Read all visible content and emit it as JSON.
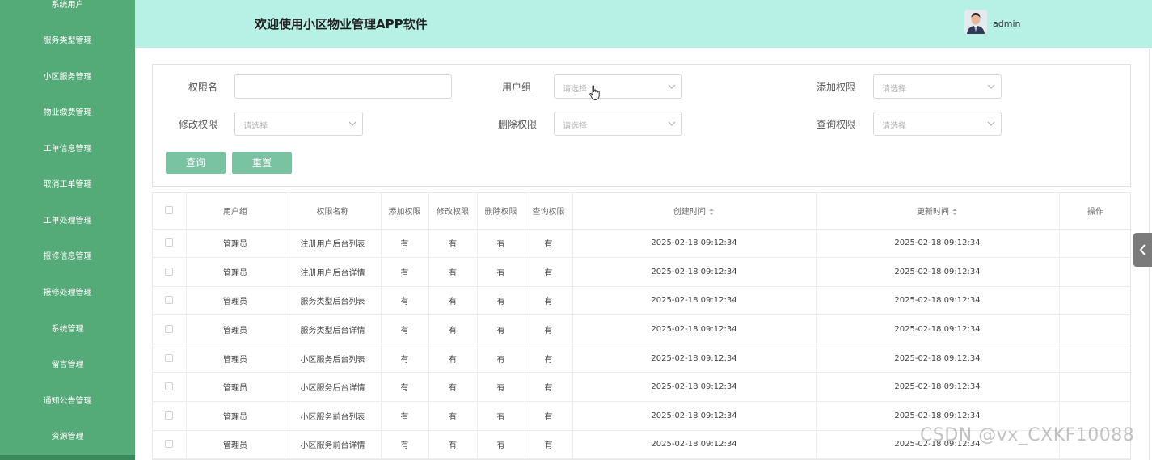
{
  "sidebar": {
    "items": [
      {
        "label": "系统用户"
      },
      {
        "label": "服务类型管理"
      },
      {
        "label": "小区服务管理"
      },
      {
        "label": "物业缴费管理"
      },
      {
        "label": "工单信息管理"
      },
      {
        "label": "取消工单管理"
      },
      {
        "label": "工单处理管理"
      },
      {
        "label": "报修信息管理"
      },
      {
        "label": "报修处理管理"
      },
      {
        "label": "系统管理"
      },
      {
        "label": "留言管理"
      },
      {
        "label": "通知公告管理"
      },
      {
        "label": "资源管理"
      }
    ]
  },
  "header": {
    "title": "欢迎使用小区物业管理APP软件",
    "username": "admin"
  },
  "search": {
    "perm_name_label": "权限名",
    "user_group_label": "用户组",
    "add_perm_label": "添加权限",
    "edit_perm_label": "修改权限",
    "delete_perm_label": "删除权限",
    "query_perm_label": "查询权限",
    "select_placeholder": "请选择",
    "perm_name_value": "",
    "query_button": "查询",
    "reset_button": "重置"
  },
  "table": {
    "headers": [
      "用户组",
      "权限名称",
      "添加权限",
      "修改权限",
      "删除权限",
      "查询权限",
      "创建时间",
      "更新时间",
      "操作"
    ],
    "rows": [
      {
        "group": "管理员",
        "name": "注册用户后台列表",
        "add": "有",
        "edit": "有",
        "del": "有",
        "query": "有",
        "created": "2025-02-18 09:12:34",
        "updated": "2025-02-18 09:12:34"
      },
      {
        "group": "管理员",
        "name": "注册用户后台详情",
        "add": "有",
        "edit": "有",
        "del": "有",
        "query": "有",
        "created": "2025-02-18 09:12:34",
        "updated": "2025-02-18 09:12:34"
      },
      {
        "group": "管理员",
        "name": "服务类型后台列表",
        "add": "有",
        "edit": "有",
        "del": "有",
        "query": "有",
        "created": "2025-02-18 09:12:34",
        "updated": "2025-02-18 09:12:34"
      },
      {
        "group": "管理员",
        "name": "服务类型后台详情",
        "add": "有",
        "edit": "有",
        "del": "有",
        "query": "有",
        "created": "2025-02-18 09:12:34",
        "updated": "2025-02-18 09:12:34"
      },
      {
        "group": "管理员",
        "name": "小区服务后台列表",
        "add": "有",
        "edit": "有",
        "del": "有",
        "query": "有",
        "created": "2025-02-18 09:12:34",
        "updated": "2025-02-18 09:12:34"
      },
      {
        "group": "管理员",
        "name": "小区服务后台详情",
        "add": "有",
        "edit": "有",
        "del": "有",
        "query": "有",
        "created": "2025-02-18 09:12:34",
        "updated": "2025-02-18 09:12:34"
      },
      {
        "group": "管理员",
        "name": "小区服务前台列表",
        "add": "有",
        "edit": "有",
        "del": "有",
        "query": "有",
        "created": "2025-02-18 09:12:34",
        "updated": "2025-02-18 09:12:34"
      },
      {
        "group": "管理员",
        "name": "小区服务前台详情",
        "add": "有",
        "edit": "有",
        "del": "有",
        "query": "有",
        "created": "2025-02-18 09:12:34",
        "updated": "2025-02-18 09:12:34"
      }
    ]
  },
  "watermark": "CSDN @vx_CXKF10088",
  "colors": {
    "sidebar_bg": "#55ab78",
    "header_bg": "#b7f0e4",
    "button_bg": "#7ac3a2"
  }
}
